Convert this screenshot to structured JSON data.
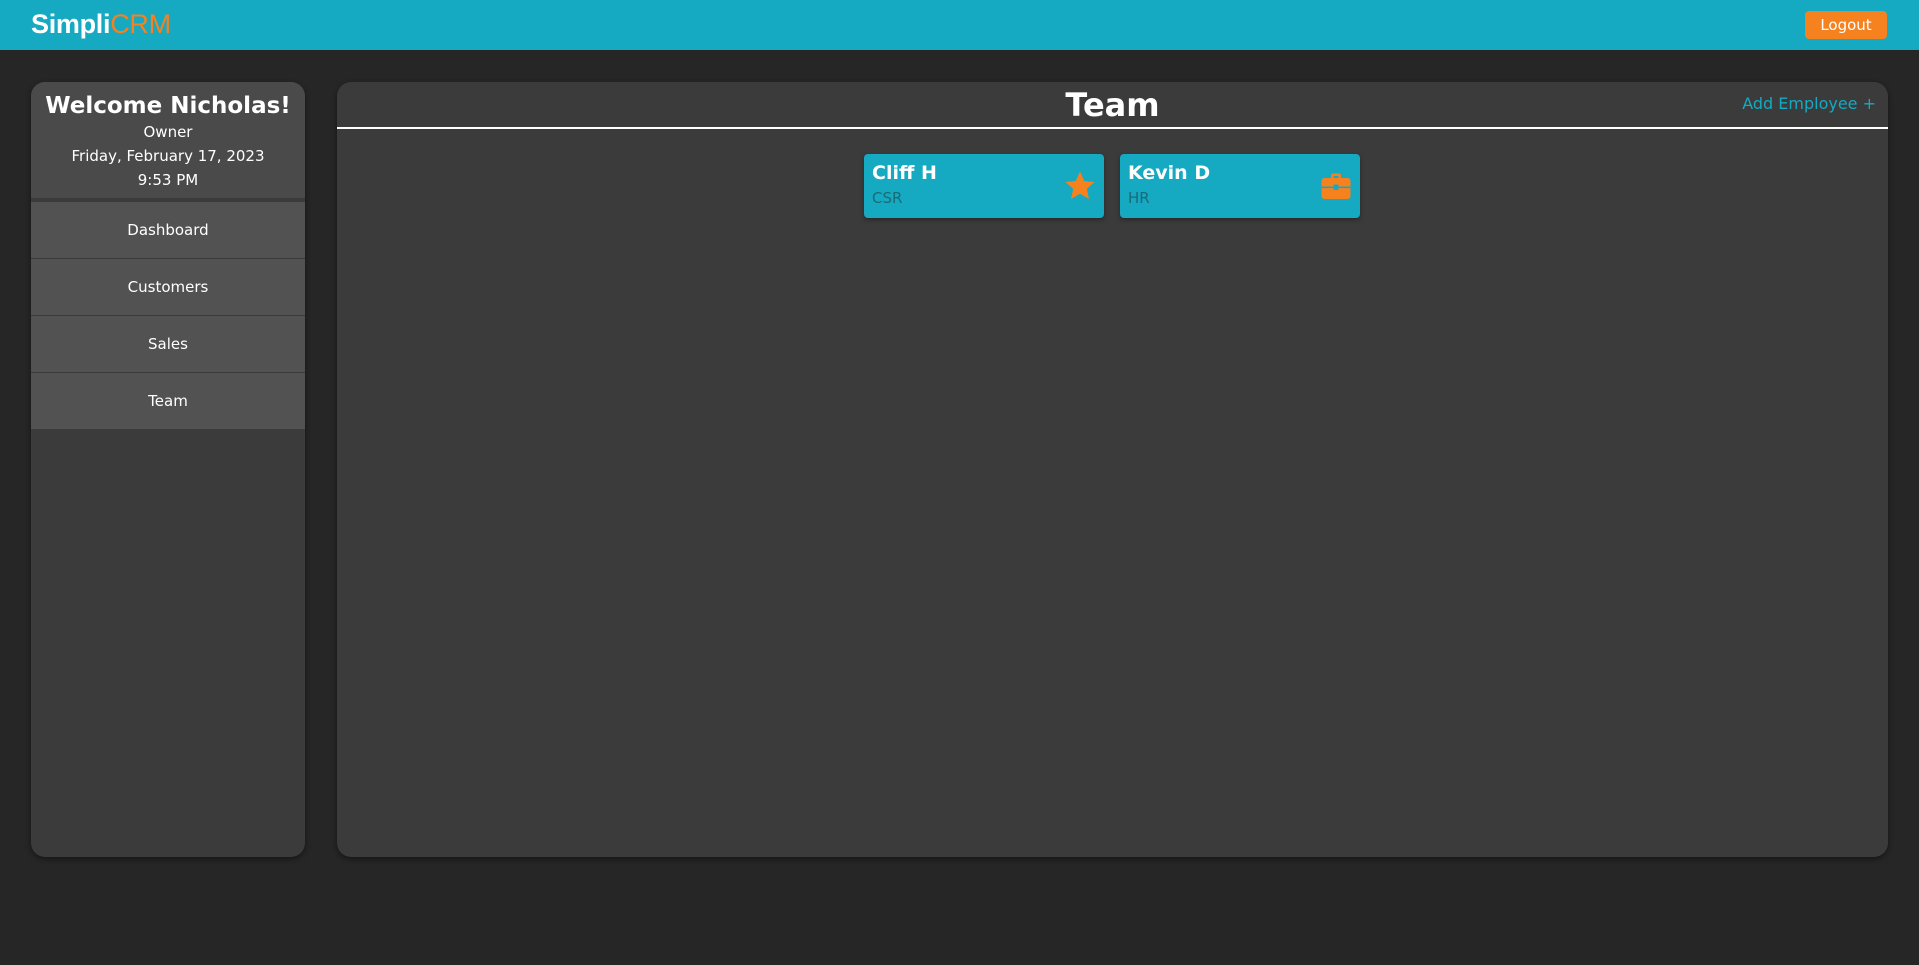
{
  "app": {
    "logo_part1": "Simpli",
    "logo_part2": "CRM",
    "logout_label": "Logout"
  },
  "sidebar": {
    "welcome": "Welcome Nicholas!",
    "role": "Owner",
    "date": "Friday, February 17, 2023",
    "time": "9:53 PM",
    "items": [
      {
        "label": "Dashboard"
      },
      {
        "label": "Customers"
      },
      {
        "label": "Sales"
      },
      {
        "label": "Team"
      }
    ]
  },
  "main": {
    "title": "Team",
    "add_label": "Add Employee +",
    "employees": [
      {
        "name": "Cliff H",
        "role": "CSR",
        "icon": "star-icon"
      },
      {
        "name": "Kevin D",
        "role": "HR",
        "icon": "briefcase-icon"
      }
    ]
  },
  "colors": {
    "brand": "#15a9c2",
    "accent": "#f5821f",
    "background": "#262626",
    "panel": "#3b3b3b"
  }
}
